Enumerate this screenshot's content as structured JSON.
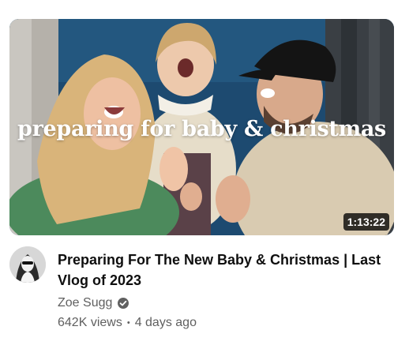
{
  "thumbnail": {
    "overlay_text": "preparing for baby & christmas",
    "duration": "1:13:22"
  },
  "video": {
    "title": "Preparing For The New Baby & Christmas | Last Vlog of 2023",
    "channel": "Zoe Sugg",
    "channel_verified": true,
    "views": "642K views",
    "separator": "•",
    "age": "4 days ago"
  },
  "icons": {
    "verified": "verified-check-icon",
    "avatar": "channel-avatar"
  },
  "colors": {
    "title_text": "#0f0f0f",
    "secondary_text": "#606060",
    "duration_badge_bg": "#000000"
  }
}
